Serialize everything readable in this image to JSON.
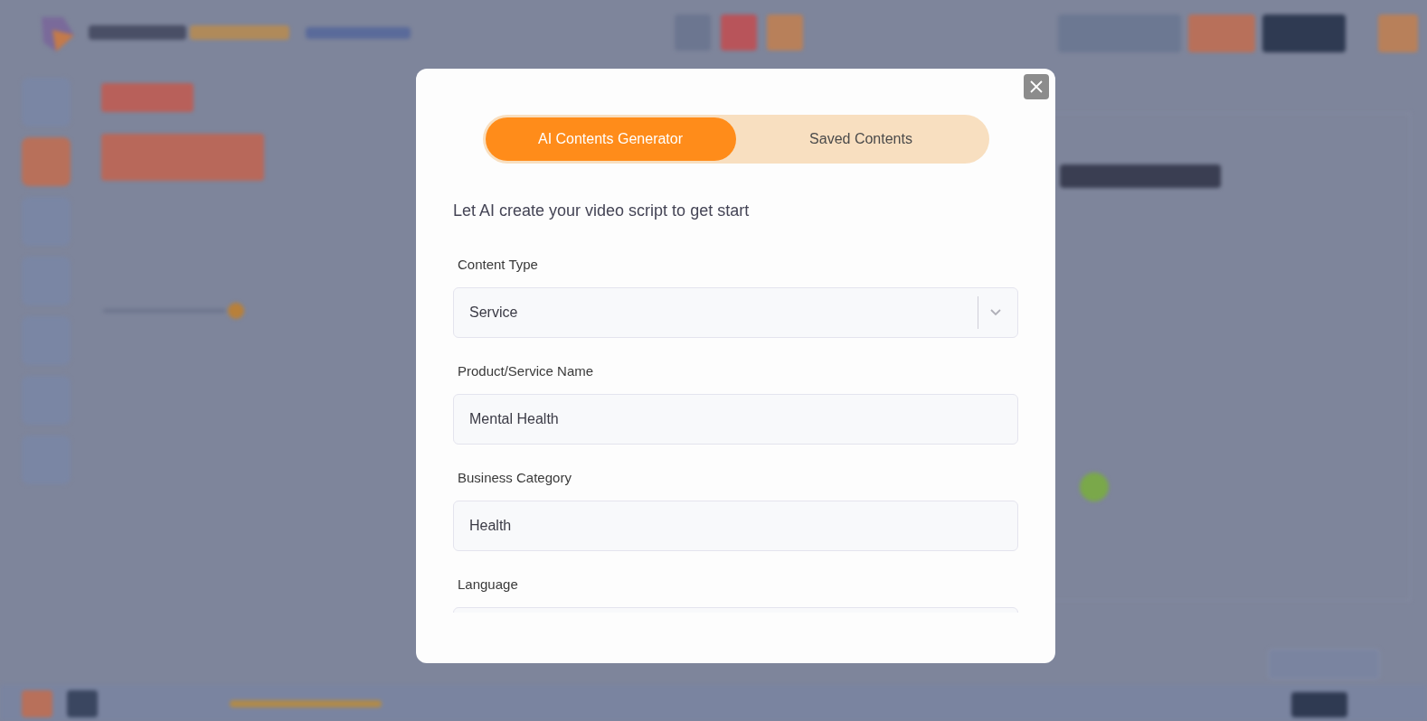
{
  "dialog": {
    "tabs": [
      {
        "label": "AI Contents Generator",
        "selected": true
      },
      {
        "label": "Saved Contents",
        "selected": false
      }
    ],
    "intro": "Let AI create your video script to get start",
    "fields": [
      {
        "kind": "select",
        "label": "Content Type",
        "value": "Service"
      },
      {
        "kind": "text",
        "label": "Product/Service Name",
        "value": "Mental Health"
      },
      {
        "kind": "text",
        "label": "Business Category",
        "value": "Health"
      },
      {
        "kind": "text",
        "label": "Language"
      }
    ]
  }
}
